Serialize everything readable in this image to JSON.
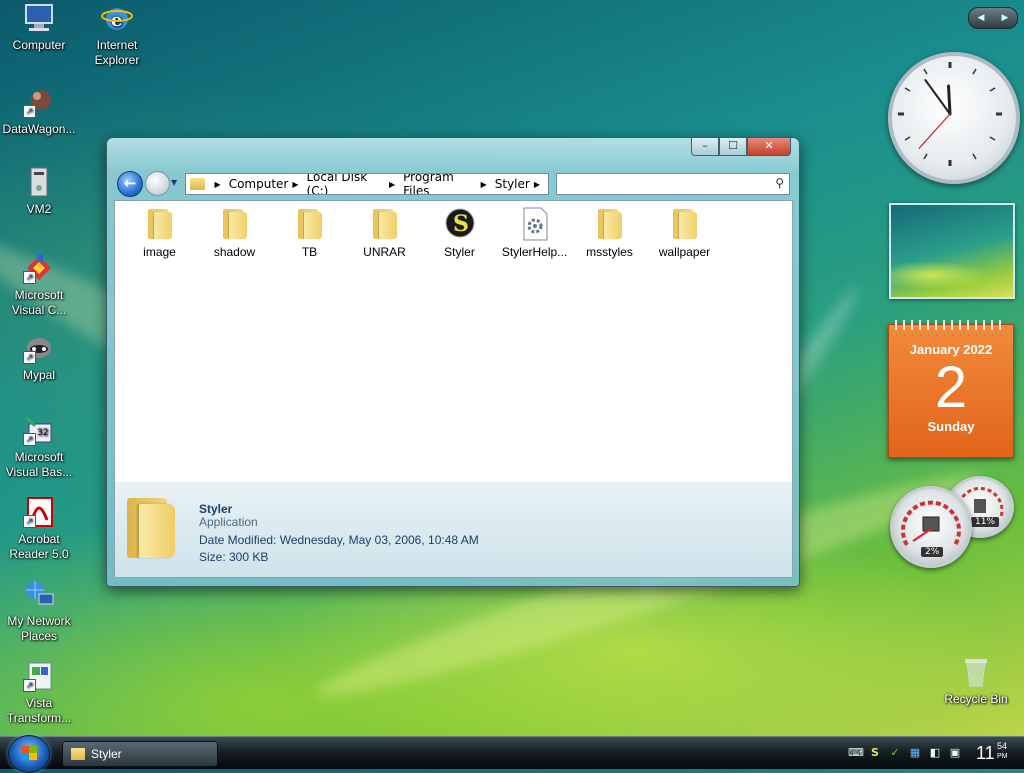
{
  "desktop_icons": [
    {
      "label": "Computer",
      "icon": "computer-icon"
    },
    {
      "label": "Internet\nExplorer",
      "icon": "internet-explorer-icon"
    },
    {
      "label": "DataWagon...",
      "icon": "datawagon-icon"
    },
    {
      "label": "VM2",
      "icon": "vm2-icon"
    },
    {
      "label": "Microsoft\nVisual C...",
      "icon": "visual-c-icon"
    },
    {
      "label": "Mypal",
      "icon": "mypal-icon"
    },
    {
      "label": "Microsoft\nVisual Bas...",
      "icon": "visual-basic-icon"
    },
    {
      "label": "Acrobat\nReader 5.0",
      "icon": "acrobat-icon"
    },
    {
      "label": "My Network\nPlaces",
      "icon": "network-places-icon"
    },
    {
      "label": "Vista\nTransform...",
      "icon": "vista-transform-icon"
    },
    {
      "label": "Recycle Bin",
      "icon": "recycle-bin-icon"
    }
  ],
  "window": {
    "caption_buttons": {
      "minimize": "–",
      "maximize": "☐",
      "close": "✕"
    },
    "nav": {
      "back": "←",
      "forward": "→",
      "dropdown": "▼"
    },
    "breadcrumb": [
      "Computer",
      "Local Disk (C:)",
      "Program Files",
      "Styler"
    ],
    "breadcrumb_separator": "▶",
    "search_placeholder": "",
    "search_icon": "⚲",
    "files": [
      {
        "name": "image",
        "type": "folder"
      },
      {
        "name": "shadow",
        "type": "folder"
      },
      {
        "name": "TB",
        "type": "folder"
      },
      {
        "name": "UNRAR",
        "type": "folder"
      },
      {
        "name": "Styler",
        "type": "application"
      },
      {
        "name": "StylerHelp...",
        "type": "settings-file"
      },
      {
        "name": "msstyles",
        "type": "folder"
      },
      {
        "name": "wallpaper",
        "type": "folder"
      }
    ],
    "details": {
      "name": "Styler",
      "type": "Application",
      "modified": "Date Modified: Wednesday, May 03, 2006, 10:48 AM",
      "size": "Size: 300 KB"
    }
  },
  "gadgets": {
    "nav": {
      "prev": "◀",
      "next": "▶"
    },
    "clock": {
      "hour": 11,
      "minute": 54,
      "second": 37
    },
    "calendar": {
      "month": "January 2022",
      "day": "2",
      "weekday": "Sunday"
    },
    "cpu_meter": {
      "cpu": "2%",
      "memory": "11%"
    }
  },
  "taskbar": {
    "task_label": "Styler",
    "tray_icons": [
      "keyboard-icon",
      "styler-tray-icon",
      "check-icon",
      "network-icon",
      "volume-icon",
      "power-icon"
    ],
    "tray_glyphs": [
      "⌨",
      "S",
      "✓",
      "▦",
      "◧",
      "▣"
    ],
    "time_hour": "11",
    "time_minute": "54",
    "time_ampm": "PM"
  },
  "colors": {
    "accent": "#1b3f6e",
    "calendar": "#e8721f",
    "taskbar": "#141c20"
  }
}
